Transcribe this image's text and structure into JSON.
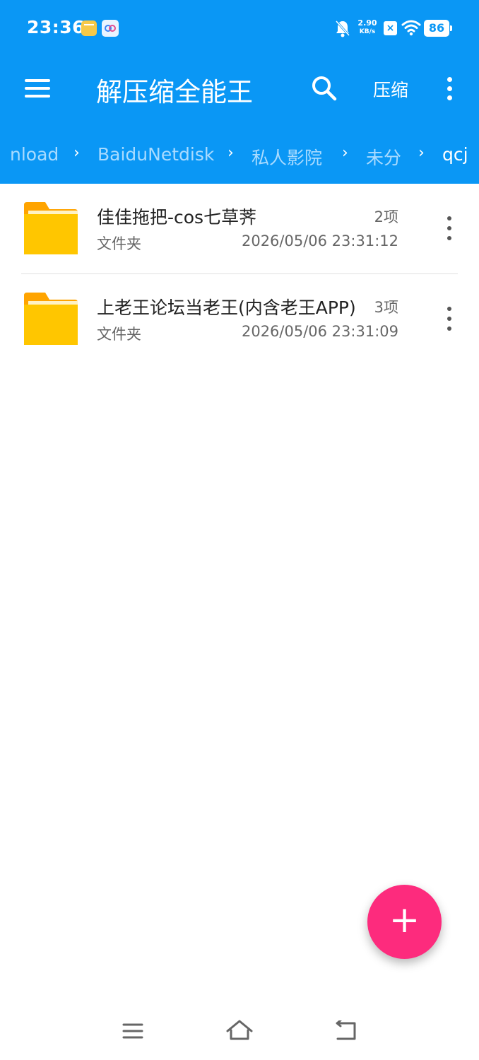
{
  "status_bar": {
    "time": "23:36",
    "net_speed_value": "2.90",
    "net_speed_unit": "KB/s",
    "battery": "86"
  },
  "toolbar": {
    "title": "解压缩全能王",
    "compress_label": "压缩"
  },
  "breadcrumb": [
    "nload",
    "BaiduNetdisk",
    "私人影院",
    "未分",
    "qcj"
  ],
  "files": [
    {
      "name": "佳佳拖把-cos七草荠",
      "count": "2项",
      "type": "文件夹",
      "date": "2026/05/06 23:31:12"
    },
    {
      "name": "上老王论坛当老王(内含老王APP)",
      "count": "3项",
      "type": "文件夹",
      "date": "2026/05/06 23:31:09"
    }
  ],
  "fab": {
    "label": "+"
  },
  "colors": {
    "primary": "#0a97f5",
    "fab": "#fd2b7d",
    "folder": "#ffc600"
  },
  "icons": [
    "menu-icon",
    "search-icon",
    "more-vert-icon",
    "folder-icon",
    "add-icon",
    "nav-recent-icon",
    "nav-home-icon",
    "nav-back-icon"
  ]
}
